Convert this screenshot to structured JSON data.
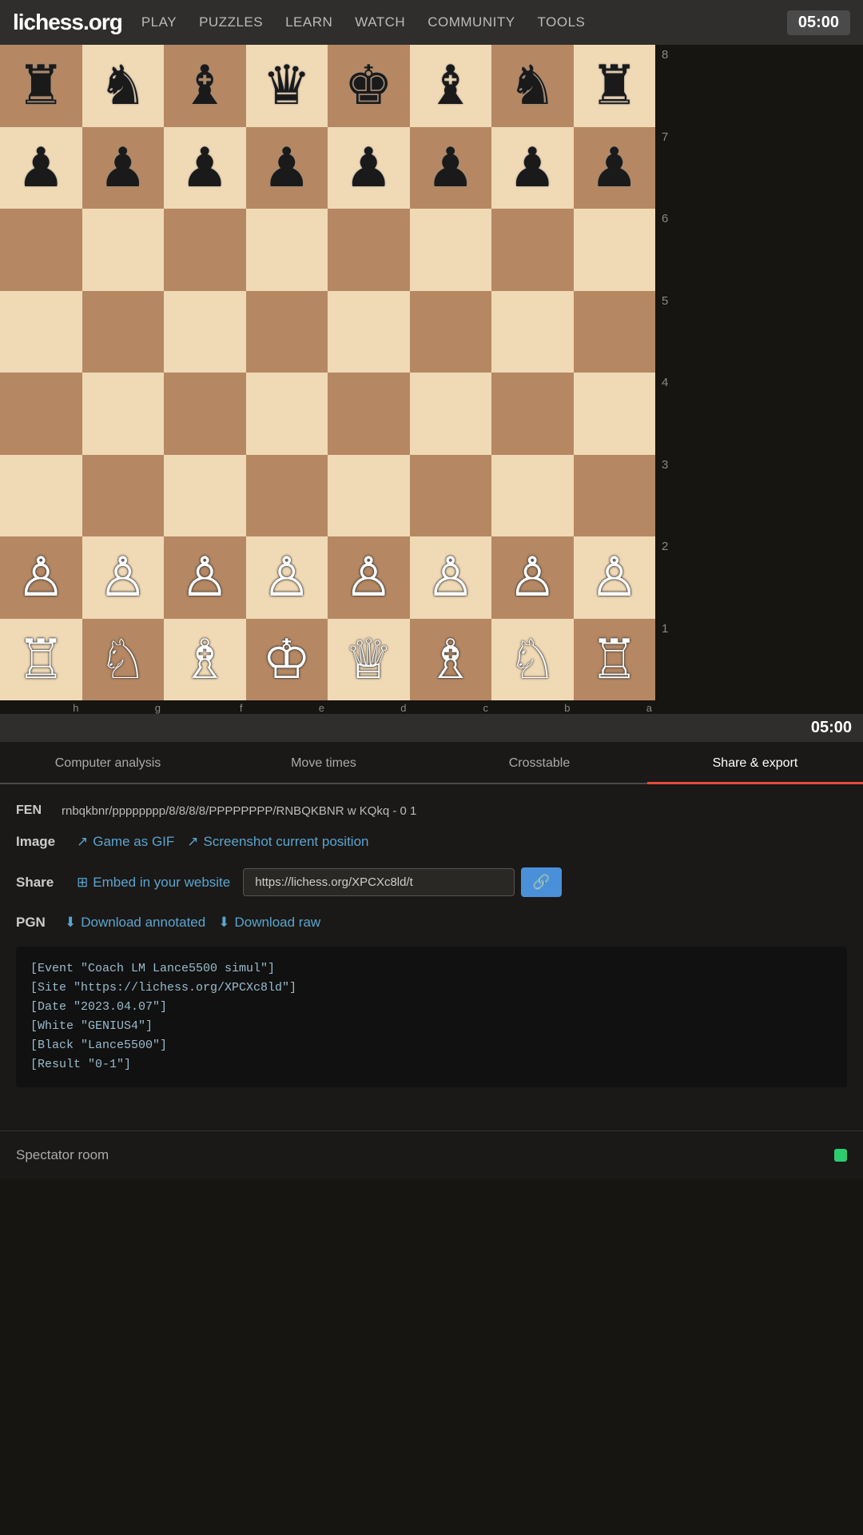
{
  "navbar": {
    "logo": "lichess.org",
    "links": [
      "PLAY",
      "PUZZLES",
      "LEARN",
      "WATCH",
      "COMMUNITY",
      "TOOLS"
    ],
    "timer_top": "05:00"
  },
  "board": {
    "ranks": [
      "8",
      "7",
      "6",
      "5",
      "4",
      "3",
      "2",
      "1"
    ],
    "files": [
      "h",
      "g",
      "f",
      "e",
      "d",
      "c",
      "b",
      "a"
    ],
    "timer_bottom": "05:00",
    "squares": [
      [
        "♜",
        "♞",
        "♝",
        "♛",
        "♚",
        "♝",
        "♞",
        "♜"
      ],
      [
        "♟",
        "♟",
        "♟",
        "♟",
        "♟",
        "♟",
        "♟",
        "♟"
      ],
      [
        " ",
        " ",
        " ",
        " ",
        " ",
        " ",
        " ",
        " "
      ],
      [
        " ",
        " ",
        " ",
        " ",
        " ",
        " ",
        " ",
        " "
      ],
      [
        " ",
        " ",
        " ",
        " ",
        " ",
        " ",
        " ",
        " "
      ],
      [
        " ",
        " ",
        " ",
        " ",
        " ",
        " ",
        " ",
        " "
      ],
      [
        "♙",
        "♙",
        "♙",
        "♙",
        "♙",
        "♙",
        "♙",
        "♙"
      ],
      [
        "♖",
        "♘",
        "♗",
        "♔",
        "♕",
        "♗",
        "♘",
        "♖"
      ]
    ],
    "piece_colors": [
      [
        "black",
        "black",
        "black",
        "black",
        "black",
        "black",
        "black",
        "black"
      ],
      [
        "black",
        "black",
        "black",
        "black",
        "black",
        "black",
        "black",
        "black"
      ],
      [
        "none",
        "none",
        "none",
        "none",
        "none",
        "none",
        "none",
        "none"
      ],
      [
        "none",
        "none",
        "none",
        "none",
        "none",
        "none",
        "none",
        "none"
      ],
      [
        "none",
        "none",
        "none",
        "none",
        "none",
        "none",
        "none",
        "none"
      ],
      [
        "none",
        "none",
        "none",
        "none",
        "none",
        "none",
        "none",
        "none"
      ],
      [
        "white",
        "white",
        "white",
        "white",
        "white",
        "white",
        "white",
        "white"
      ],
      [
        "white",
        "white",
        "white",
        "white",
        "white",
        "white",
        "white",
        "white"
      ]
    ]
  },
  "tabs": {
    "items": [
      {
        "label": "Computer analysis",
        "active": false
      },
      {
        "label": "Move times",
        "active": false
      },
      {
        "label": "Crosstable",
        "active": false
      },
      {
        "label": "Share & export",
        "active": true
      }
    ]
  },
  "share_export": {
    "fen_label": "FEN",
    "fen_value": "rnbqkbnr/pppppppp/8/8/8/8/PPPPPPPP/RNBQKBNR w KQkq - 0 1",
    "image_label": "Image",
    "game_as_gif_label": "Game as GIF",
    "screenshot_label": "Screenshot current position",
    "share_label": "Share",
    "embed_label": "Embed in your website",
    "share_url": "https://lichess.org/XPCXc8ld/t",
    "copy_icon": "🔗",
    "pgn_label": "PGN",
    "download_annotated_label": "Download annotated",
    "download_raw_label": "Download raw",
    "pgn_content": "[Event \"Coach LM Lance5500 simul\"]\n[Site \"https://lichess.org/XPCXc8ld\"]\n[Date \"2023.04.07\"]\n[White \"GENIUS4\"]\n[Black \"Lance5500\"]\n[Result \"0-1\"]"
  },
  "spectator": {
    "label": "Spectator room",
    "dot_color": "#2ecc71"
  }
}
